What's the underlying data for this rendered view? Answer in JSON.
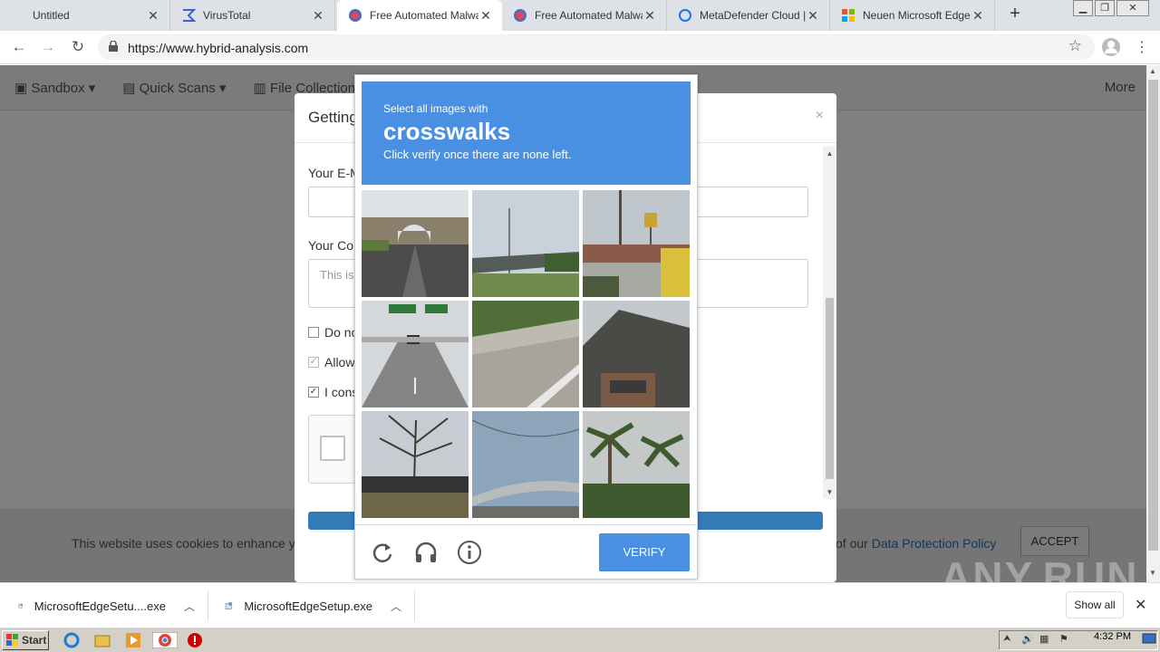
{
  "browser": {
    "tabs": [
      {
        "title": "Untitled",
        "active": false
      },
      {
        "title": "VirusTotal",
        "active": false
      },
      {
        "title": "Free Automated Malware",
        "active": true
      },
      {
        "title": "Free Automated Malware",
        "active": false
      },
      {
        "title": "MetaDefender Cloud | R",
        "active": false
      },
      {
        "title": "Neuen Microsoft Edge-Br",
        "active": false
      }
    ],
    "url": "https://www.hybrid-analysis.com"
  },
  "site": {
    "nav": [
      "Sandbox",
      "Quick Scans",
      "File Collection"
    ],
    "more": "More"
  },
  "modal": {
    "title": "Getting",
    "email_label": "Your E-M",
    "comment_label": "Your Cor",
    "comment_placeholder": "This is",
    "check1": "Do no",
    "check2": "Allow",
    "check3": "I cons"
  },
  "cookie": {
    "text": "This website uses cookies to enhance yo",
    "policy_prefix": "of our ",
    "policy_link": "Data Protection Policy",
    "accept": "ACCEPT"
  },
  "captcha": {
    "line1": "Select all images with",
    "keyword": "crosswalks",
    "line3": "Click verify once there are none left.",
    "verify": "VERIFY",
    "tiles": [
      "bridge-overpass",
      "highway-bridge-pole",
      "street-signs",
      "highway-traffic",
      "overpass-railing",
      "roof-house",
      "tree-bridge",
      "overpass-sky",
      "palm-trees"
    ]
  },
  "downloads": {
    "items": [
      "MicrosoftEdgeSetu....exe",
      "MicrosoftEdgeSetup.exe"
    ],
    "show_all": "Show all"
  },
  "taskbar": {
    "start": "Start",
    "clock": "4:32 PM"
  },
  "watermark": "ANY.RUN"
}
